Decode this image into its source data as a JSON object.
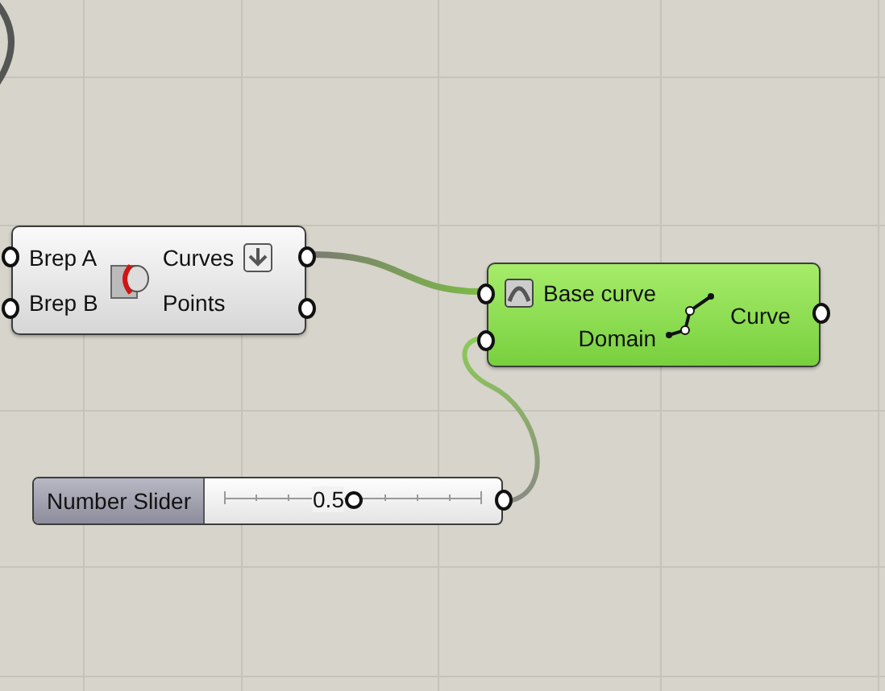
{
  "canvas": {
    "nodes": [
      {
        "kind": "component",
        "selected": false,
        "inputs": [
          "Brep A",
          "Brep B"
        ],
        "outputs": [
          "Curves",
          "Points"
        ]
      },
      {
        "kind": "component",
        "selected": true,
        "inputs": [
          "Base curve",
          "Domain"
        ],
        "outputs": [
          "Curve"
        ]
      },
      {
        "kind": "slider",
        "label": "Number Slider",
        "value": "0.5",
        "level": 0.5
      }
    ]
  }
}
